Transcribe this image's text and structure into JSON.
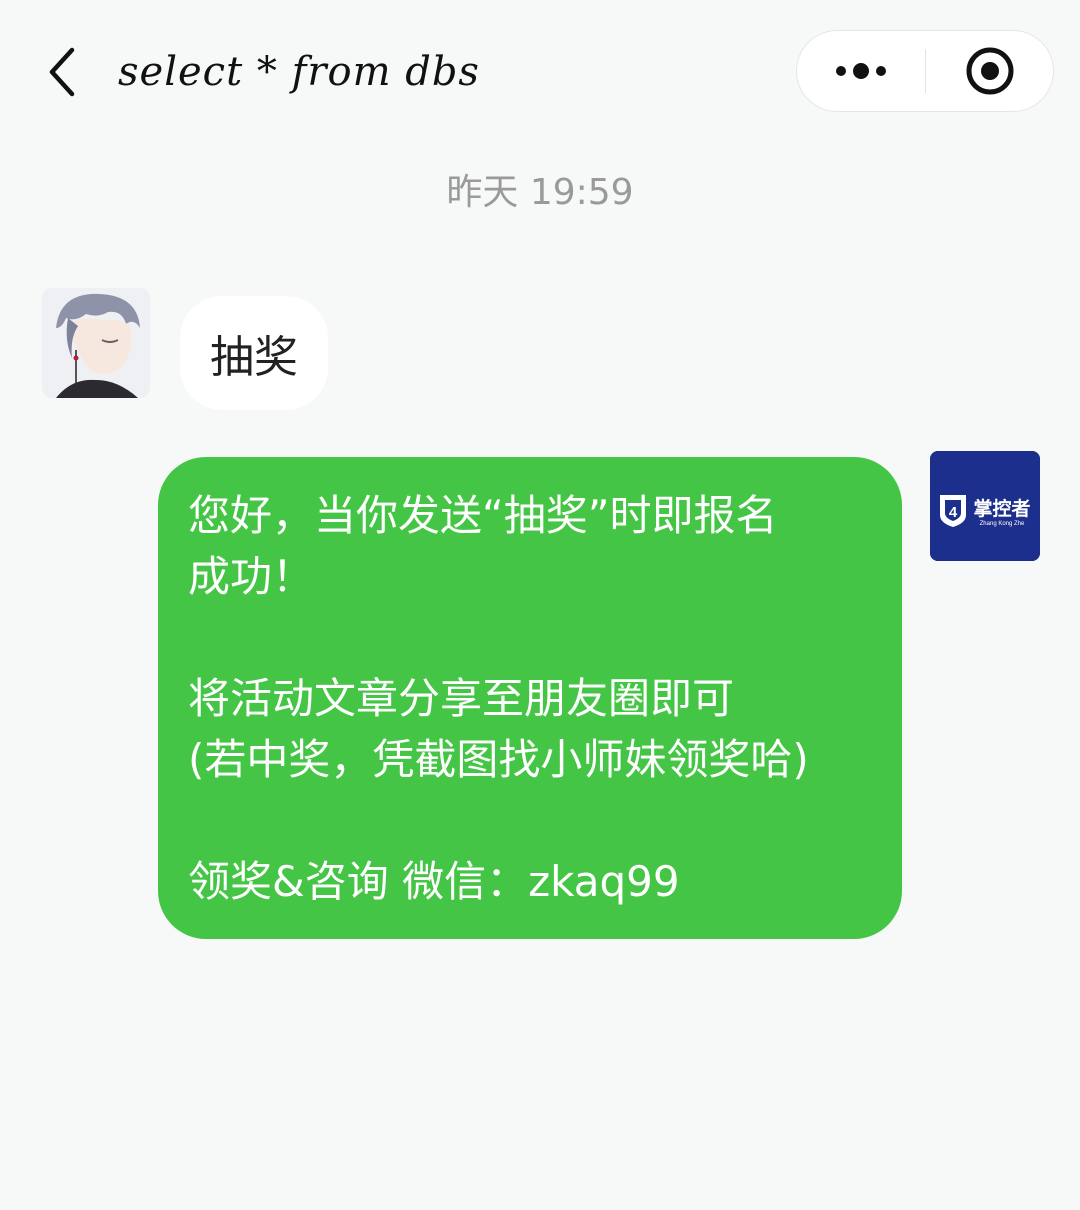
{
  "header": {
    "title": "select * from dbs"
  },
  "chat": {
    "timestamp": "昨天 19:59",
    "incoming": {
      "text": "抽奖"
    },
    "outgoing": {
      "lines": [
        "您好，当你发送“抽奖”时即报名",
        "成功！",
        "",
        "将活动文章分享至朋友圈即可",
        "(若中奖，凭截图找小师妹领奖哈)",
        "",
        "领奖&咨询 微信：zkaq99"
      ],
      "avatar_logo": {
        "text": "掌控者",
        "subtext": "Zhang Kong Zhe",
        "color": "#1d2f8c"
      }
    }
  },
  "colors": {
    "background": "#f7f8f8",
    "bubble_out": "#45c545",
    "bubble_in": "#ffffff"
  }
}
